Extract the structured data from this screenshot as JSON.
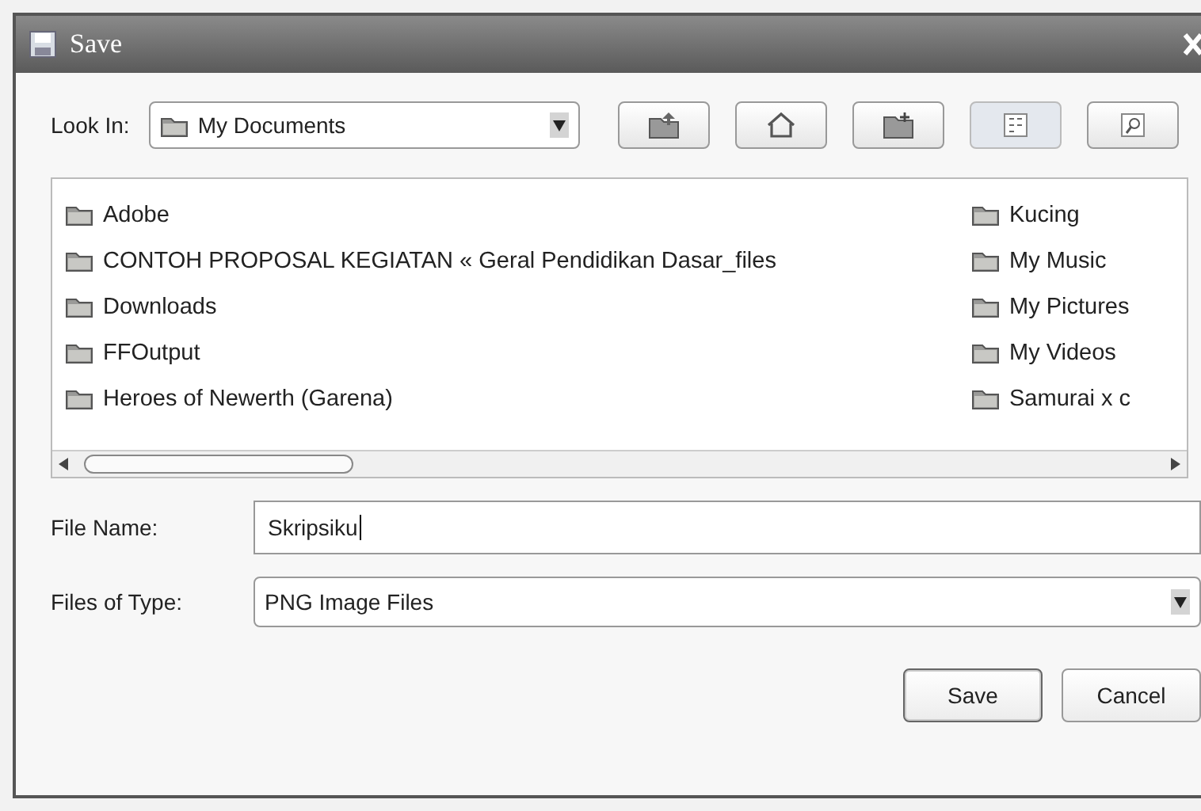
{
  "window": {
    "title": "Save"
  },
  "look_in": {
    "label": "Look In:",
    "value": "My Documents"
  },
  "toolbar": [
    {
      "kind": "up",
      "selected": false
    },
    {
      "kind": "home",
      "selected": false
    },
    {
      "kind": "new-folder",
      "selected": false
    },
    {
      "kind": "list",
      "selected": true
    },
    {
      "kind": "details",
      "selected": false
    }
  ],
  "file_list": {
    "columns": [
      {
        "items": [
          "Adobe",
          "CONTOH PROPOSAL KEGIATAN « Geral Pendidikan Dasar_files",
          "Downloads",
          "FFOutput",
          "Heroes of Newerth (Garena)"
        ]
      },
      {
        "items": [
          "Kucing",
          "My Music",
          "My Pictures",
          "My Videos",
          "Samurai x c"
        ]
      }
    ]
  },
  "file_name": {
    "label": "File Name:",
    "value": "Skripsiku"
  },
  "file_type": {
    "label": "Files of Type:",
    "value": "PNG Image Files"
  },
  "buttons": [
    {
      "label": "Save",
      "selected": true
    },
    {
      "label": "Cancel",
      "selected": false
    }
  ]
}
